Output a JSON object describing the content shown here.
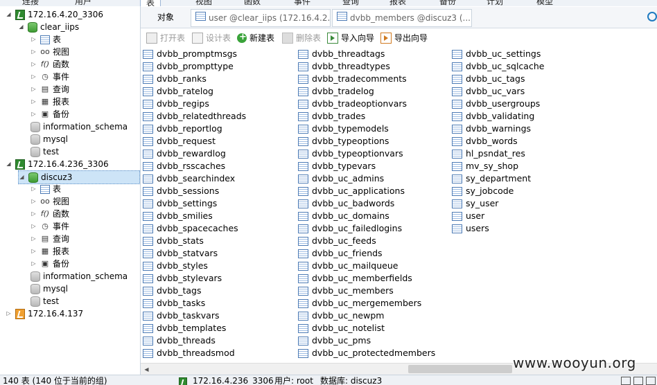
{
  "menu": [
    "连接",
    "用户",
    "表",
    "视图",
    "函数",
    "事件",
    "查询",
    "报表",
    "备份",
    "计划",
    "模型"
  ],
  "tree": {
    "conn1": "172.16.4.20_3306",
    "db1": "clear_iips",
    "categories": [
      "表",
      "视图",
      "函数",
      "事件",
      "查询",
      "报表",
      "备份"
    ],
    "db_info": "information_schema",
    "db_mysql": "mysql",
    "db_test": "test",
    "conn2": "172.16.4.236_3306",
    "db2": "discuz3",
    "conn3": "172.16.4.137"
  },
  "tabs": {
    "objects": "对象",
    "tab1": "user @clear_iips (172.16.4.2...",
    "tab2": "dvbb_members @discuz3 (..."
  },
  "toolbar": {
    "open": "打开表",
    "design": "设计表",
    "new": "新建表",
    "delete": "删除表",
    "import": "导入向导",
    "export": "导出向导"
  },
  "tables": {
    "col1": [
      "dvbb_promptmsgs",
      "dvbb_prompttype",
      "dvbb_ranks",
      "dvbb_ratelog",
      "dvbb_regips",
      "dvbb_relatedthreads",
      "dvbb_reportlog",
      "dvbb_request",
      "dvbb_rewardlog",
      "dvbb_rsscaches",
      "dvbb_searchindex",
      "dvbb_sessions",
      "dvbb_settings",
      "dvbb_smilies",
      "dvbb_spacecaches",
      "dvbb_stats",
      "dvbb_statvars",
      "dvbb_styles",
      "dvbb_stylevars",
      "dvbb_tags",
      "dvbb_tasks",
      "dvbb_taskvars",
      "dvbb_templates",
      "dvbb_threads",
      "dvbb_threadsmod"
    ],
    "col2": [
      "dvbb_threadtags",
      "dvbb_threadtypes",
      "dvbb_tradecomments",
      "dvbb_tradelog",
      "dvbb_tradeoptionvars",
      "dvbb_trades",
      "dvbb_typemodels",
      "dvbb_typeoptions",
      "dvbb_typeoptionvars",
      "dvbb_typevars",
      "dvbb_uc_admins",
      "dvbb_uc_applications",
      "dvbb_uc_badwords",
      "dvbb_uc_domains",
      "dvbb_uc_failedlogins",
      "dvbb_uc_feeds",
      "dvbb_uc_friends",
      "dvbb_uc_mailqueue",
      "dvbb_uc_memberfields",
      "dvbb_uc_members",
      "dvbb_uc_mergemembers",
      "dvbb_uc_newpm",
      "dvbb_uc_notelist",
      "dvbb_uc_pms",
      "dvbb_uc_protectedmembers"
    ],
    "col3": [
      "dvbb_uc_settings",
      "dvbb_uc_sqlcache",
      "dvbb_uc_tags",
      "dvbb_uc_vars",
      "dvbb_usergroups",
      "dvbb_validating",
      "dvbb_warnings",
      "dvbb_words",
      "hl_psndat_res",
      "mv_sy_shop",
      "sy_department",
      "sy_jobcode",
      "sy_user",
      "user",
      "users"
    ]
  },
  "status": {
    "count": "140 表 (140 位于当前的组)",
    "conn": "172.16.4.236_3306",
    "user": "用户: root",
    "db": "数据库: discuz3"
  },
  "watermark": "www.wooyun.org"
}
